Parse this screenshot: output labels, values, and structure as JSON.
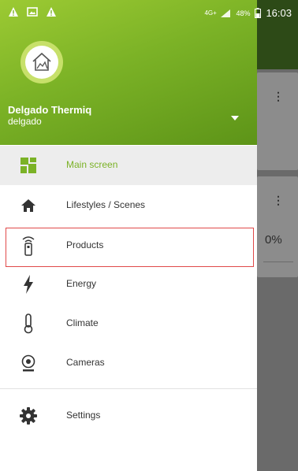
{
  "status_bar": {
    "network": "4G+",
    "battery": "48%",
    "time": "16:03"
  },
  "account": {
    "name": "Delgado Thermiq",
    "id": "delgado"
  },
  "menu": [
    {
      "label": "Main screen",
      "icon": "dashboard-icon",
      "selected": true
    },
    {
      "label": "Lifestyles / Scenes",
      "icon": "home-icon"
    },
    {
      "label": "Products",
      "icon": "remote-icon",
      "highlighted": true
    },
    {
      "label": "Energy",
      "icon": "lightning-icon"
    },
    {
      "label": "Climate",
      "icon": "thermometer-icon"
    },
    {
      "label": "Cameras",
      "icon": "camera-icon"
    }
  ],
  "settings": {
    "label": "Settings",
    "icon": "gear-icon"
  },
  "background": {
    "card2_value": "0%"
  },
  "colors": {
    "accent": "#7bb226",
    "header_green": "#8fc031",
    "highlight_red": "#e04949"
  }
}
